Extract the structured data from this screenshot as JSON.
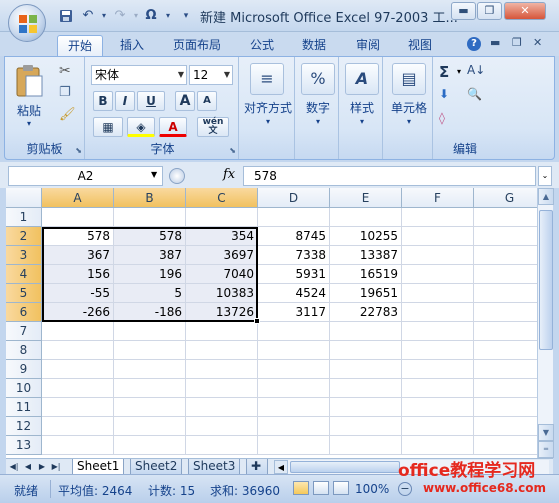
{
  "window": {
    "title": "新建 Microsoft Office Excel 97-2003 工...",
    "minimize": "▬",
    "maximize": "❐",
    "close": "✕"
  },
  "qat": {
    "save_icon": "save-icon",
    "undo_icon": "undo-icon",
    "redo_icon": "redo-icon",
    "omega": "Ω"
  },
  "ribbon": {
    "tabs": [
      "开始",
      "插入",
      "页面布局",
      "公式",
      "数据",
      "审阅",
      "视图"
    ],
    "active_tab": "开始",
    "clipboard": {
      "label": "剪贴板",
      "paste": "粘贴"
    },
    "font": {
      "label": "字体",
      "font_name": "宋体",
      "font_size": "12",
      "bold": "B",
      "italic": "I",
      "underline": "U",
      "grow": "A",
      "shrink": "A",
      "font_color": "A",
      "phonetic": "wén 文"
    },
    "alignment": {
      "label": "对齐方式"
    },
    "number": {
      "label": "数字",
      "symbol": "%"
    },
    "styles": {
      "label": "样式"
    },
    "cells": {
      "label": "单元格"
    },
    "editing": {
      "label": "编辑",
      "sum": "Σ"
    }
  },
  "formula_bar": {
    "name_box": "A2",
    "fx": "fx",
    "value": "578"
  },
  "grid": {
    "columns": [
      "A",
      "B",
      "C",
      "D",
      "E",
      "F",
      "G"
    ],
    "selected_columns": [
      "A",
      "B",
      "C"
    ],
    "rows": [
      "1",
      "2",
      "3",
      "4",
      "5",
      "6",
      "7",
      "8",
      "9",
      "10",
      "11",
      "12",
      "13"
    ],
    "selected_rows": [
      "2",
      "3",
      "4",
      "5",
      "6"
    ],
    "data": [
      [
        "",
        "",
        "",
        "",
        ""
      ],
      [
        "578",
        "578",
        "354",
        "8745",
        "10255"
      ],
      [
        "367",
        "387",
        "3697",
        "7338",
        "13387"
      ],
      [
        "156",
        "196",
        "7040",
        "5931",
        "16519"
      ],
      [
        "-55",
        "5",
        "10383",
        "4524",
        "19651"
      ],
      [
        "-266",
        "-186",
        "13726",
        "3117",
        "22783"
      ]
    ]
  },
  "sheets": [
    "Sheet1",
    "Sheet2",
    "Sheet3"
  ],
  "active_sheet": "Sheet1",
  "status": {
    "mode": "就绪",
    "average": "平均值: 2464",
    "count": "计数: 15",
    "sum": "求和: 36960",
    "zoom": "100%"
  },
  "watermark": {
    "line1": "office教程学习网",
    "line2": "www.office68.com"
  }
}
